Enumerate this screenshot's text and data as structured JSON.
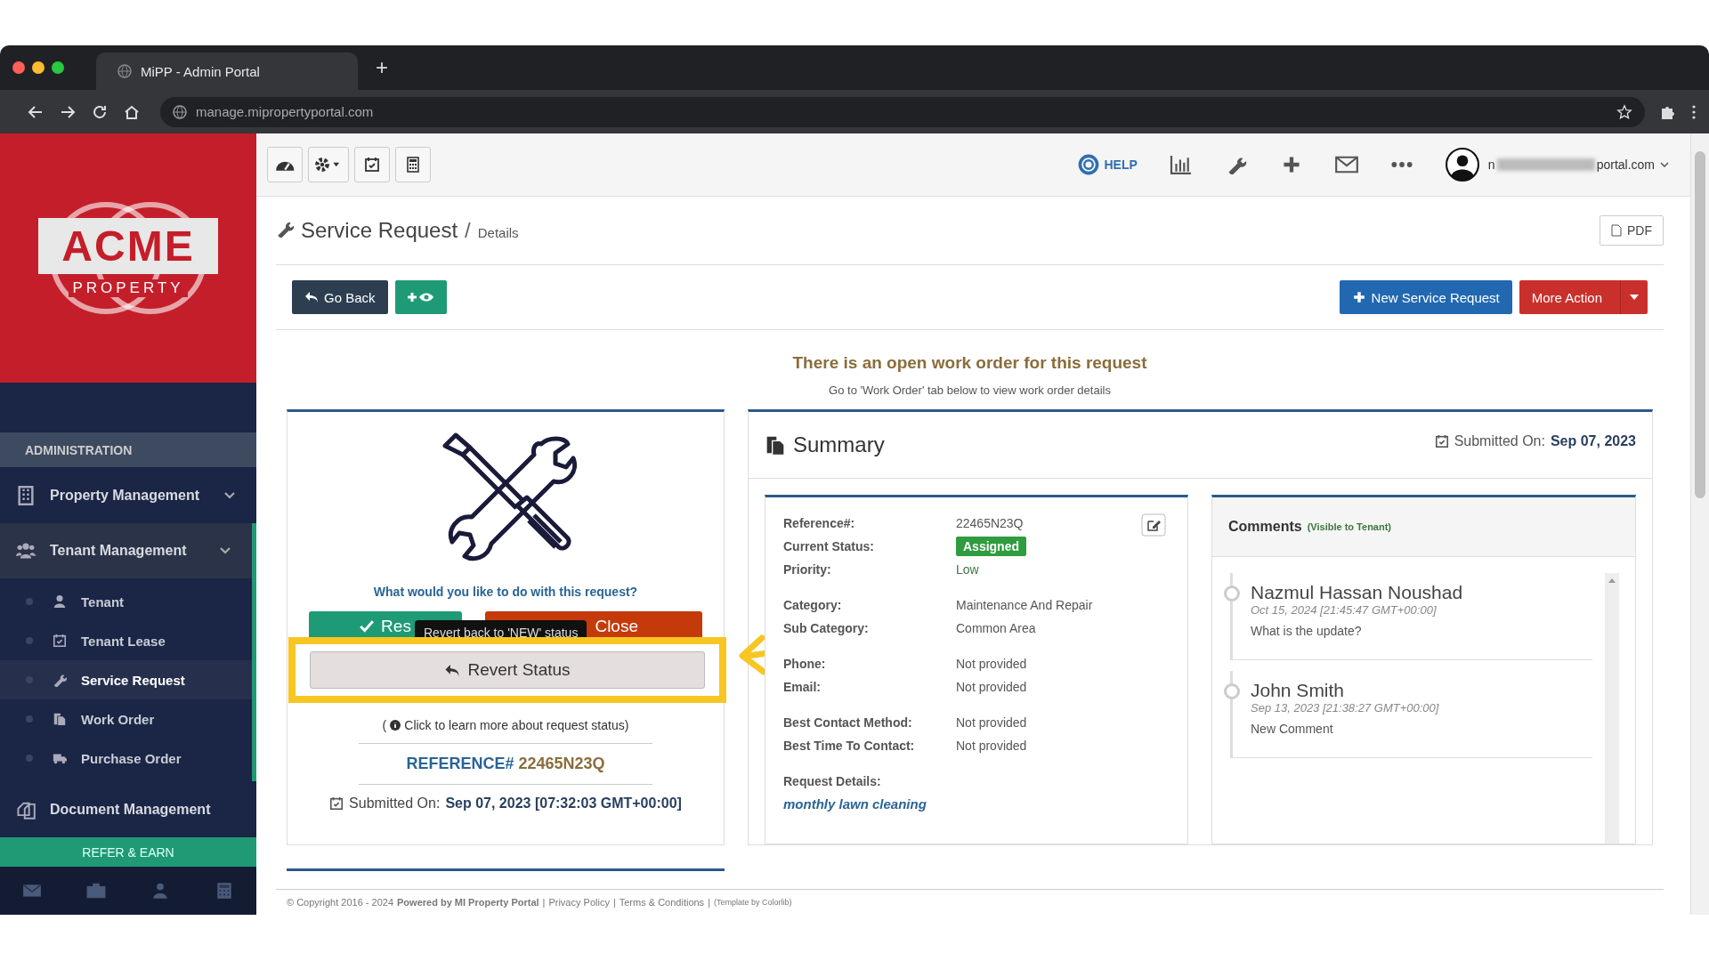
{
  "browser": {
    "tab_title": "MiPP - Admin Portal",
    "new_tab": "+",
    "url": "manage.mipropertyportal.com"
  },
  "sidebar": {
    "logo": {
      "name": "ACME",
      "sub": "PROPERTY"
    },
    "section": "ADMINISTRATION",
    "items": [
      {
        "label": "Property Management",
        "expanded": false
      },
      {
        "label": "Tenant Management",
        "expanded": true,
        "children": [
          {
            "label": "Tenant",
            "selected": false
          },
          {
            "label": "Tenant Lease",
            "selected": false
          },
          {
            "label": "Service Request",
            "selected": true
          },
          {
            "label": "Work Order",
            "selected": false
          },
          {
            "label": "Purchase Order",
            "selected": false
          }
        ]
      },
      {
        "label": "Document Management"
      }
    ],
    "refer": "REFER & EARN"
  },
  "header": {
    "help": "HELP",
    "email_start": "n",
    "email_end": "portal.com"
  },
  "page": {
    "title": "Service Request",
    "separator": "/",
    "crumb": "Details",
    "pdf": "PDF",
    "go_back": "Go Back",
    "new_request": "New Service Request",
    "more_action": "More Action",
    "notice": "There is an open work order for this request",
    "notice_sub": "Go to 'Work Order' tab below to view work order details"
  },
  "action_card": {
    "question": "What would you like to do with this request?",
    "resolve": "Res",
    "close": "Close",
    "tooltip": "Revert back to 'NEW' status",
    "revert": "Revert Status",
    "learn_open": "(",
    "learn_more": "Click to learn more about request status)",
    "ref_label": "REFERENCE#",
    "ref_value": "22465N23Q",
    "submitted_label": "Submitted On:",
    "submitted_value": "Sep 07, 2023 [07:32:03 GMT+00:00]"
  },
  "summary": {
    "title": "Summary",
    "submitted_label": "Submitted On:",
    "submitted_value": "Sep 07, 2023",
    "fields": [
      {
        "label": "Reference#:",
        "value": "22465N23Q",
        "kind": "text"
      },
      {
        "label": "Current Status:",
        "value": "Assigned",
        "kind": "badge"
      },
      {
        "label": "Priority:",
        "value": "Low",
        "kind": "green"
      },
      {
        "label": "Category:",
        "value": "Maintenance And Repair",
        "kind": "text"
      },
      {
        "label": "Sub Category:",
        "value": "Common Area",
        "kind": "text"
      },
      {
        "label": "Phone:",
        "value": "Not provided",
        "kind": "text"
      },
      {
        "label": "Email:",
        "value": "Not provided",
        "kind": "text"
      },
      {
        "label": "Best Contact Method:",
        "value": "Not provided",
        "kind": "text"
      },
      {
        "label": "Best Time To Contact:",
        "value": "Not provided",
        "kind": "text"
      }
    ],
    "details_label": "Request Details:",
    "details": "monthly lawn cleaning"
  },
  "comments": {
    "title": "Comments",
    "note": "(Visible to Tenant)",
    "items": [
      {
        "author": "Nazmul Hassan Noushad",
        "time": "Oct 15, 2024 [21:45:47 GMT+00:00]",
        "text": "What is the update?"
      },
      {
        "author": "John Smith",
        "time": "Sep 13, 2023 [21:38:27 GMT+00:00]",
        "text": "New Comment"
      }
    ]
  },
  "footer": {
    "copyright": "© Copyright 2016 - 2024",
    "powered": "Powered by MI Property Portal",
    "sep1": "|",
    "privacy": "Privacy Policy",
    "sep2": "|",
    "terms": "Terms & Conditions",
    "sep3": "|",
    "template": "(Template by Colorlib)"
  }
}
